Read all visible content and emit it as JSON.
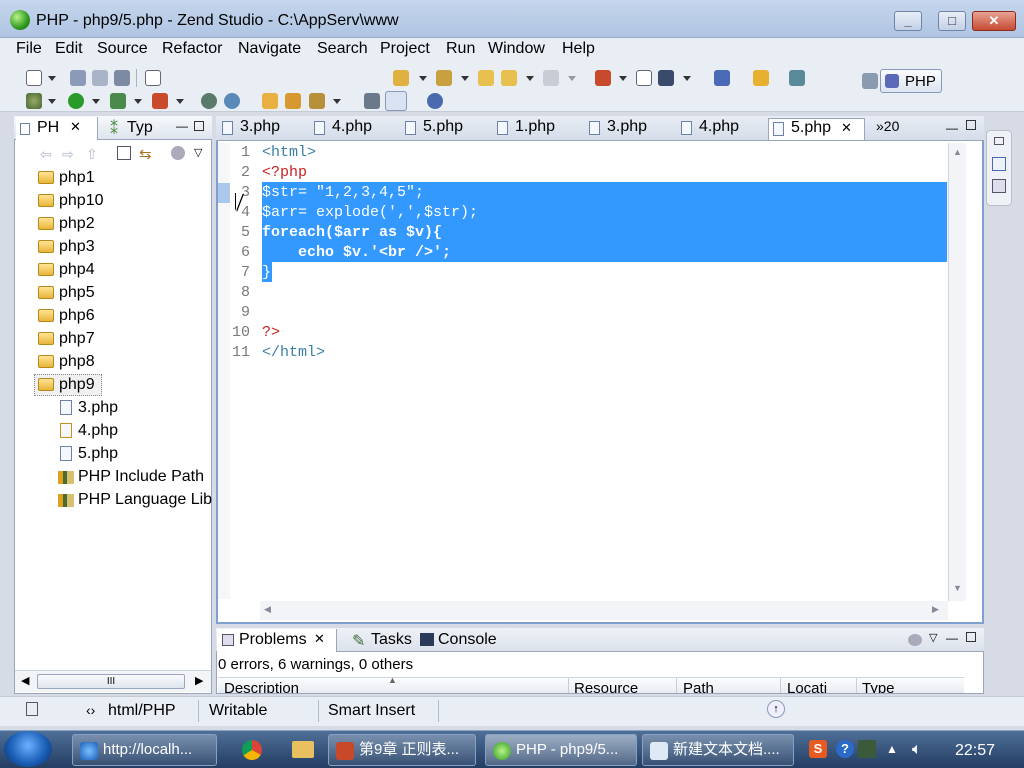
{
  "window": {
    "title": "PHP - php9/5.php - Zend Studio - C:\\AppServ\\www"
  },
  "window_controls": {
    "minimize": "_",
    "maximize": "□",
    "close": "✕"
  },
  "menu": [
    "File",
    "Edit",
    "Source",
    "Refactor",
    "Navigate",
    "Search",
    "Project",
    "Run",
    "Window",
    "Help"
  ],
  "perspective": {
    "label": "PHP"
  },
  "left_view": {
    "tabs": [
      "PH",
      "Typ"
    ],
    "tree": [
      "php1",
      "php10",
      "php2",
      "php3",
      "php4",
      "php5",
      "php6",
      "php7",
      "php8",
      "php9"
    ],
    "children": [
      "3.php",
      "4.php",
      "5.php",
      "PHP Include Path",
      "PHP Language Lib"
    ],
    "hscroll_label": "III"
  },
  "editor": {
    "tabs": [
      "3.php",
      "4.php",
      "5.php",
      "1.php",
      "3.php",
      "4.php",
      "5.php"
    ],
    "overflow": "»20",
    "line_numbers": [
      "1",
      "2",
      "3",
      "4",
      "5",
      "6",
      "7",
      "8",
      "9",
      "10",
      "11"
    ],
    "lines": [
      "<html>",
      "<?php",
      "$str= \"1,2,3,4,5\";",
      "$arr= explode(',',$str);",
      "foreach($arr as $v){",
      "    echo $v.'<br />';",
      "}",
      "",
      "",
      "?>",
      "</html>"
    ],
    "selected_lines": [
      3,
      4,
      5,
      6,
      7
    ]
  },
  "problems": {
    "tabs": [
      "Problems",
      "Tasks",
      "Console"
    ],
    "summary": "0 errors, 6 warnings, 0 others",
    "columns": [
      "Description",
      "Resource",
      "Path",
      "Locati",
      "Type"
    ]
  },
  "status": {
    "content_type": "html/PHP",
    "mode": "Writable",
    "insert": "Smart Insert"
  },
  "taskbar": {
    "items": [
      "http://localh...",
      "第9章 正则表...",
      "PHP - php9/5...",
      "新建文本文档...."
    ],
    "clock": "22:57"
  },
  "colors": {
    "selection": "#3399ff",
    "php_tag": "#c81f1f",
    "html_tag": "#3c7fa6",
    "keyword": "#7f0055"
  }
}
